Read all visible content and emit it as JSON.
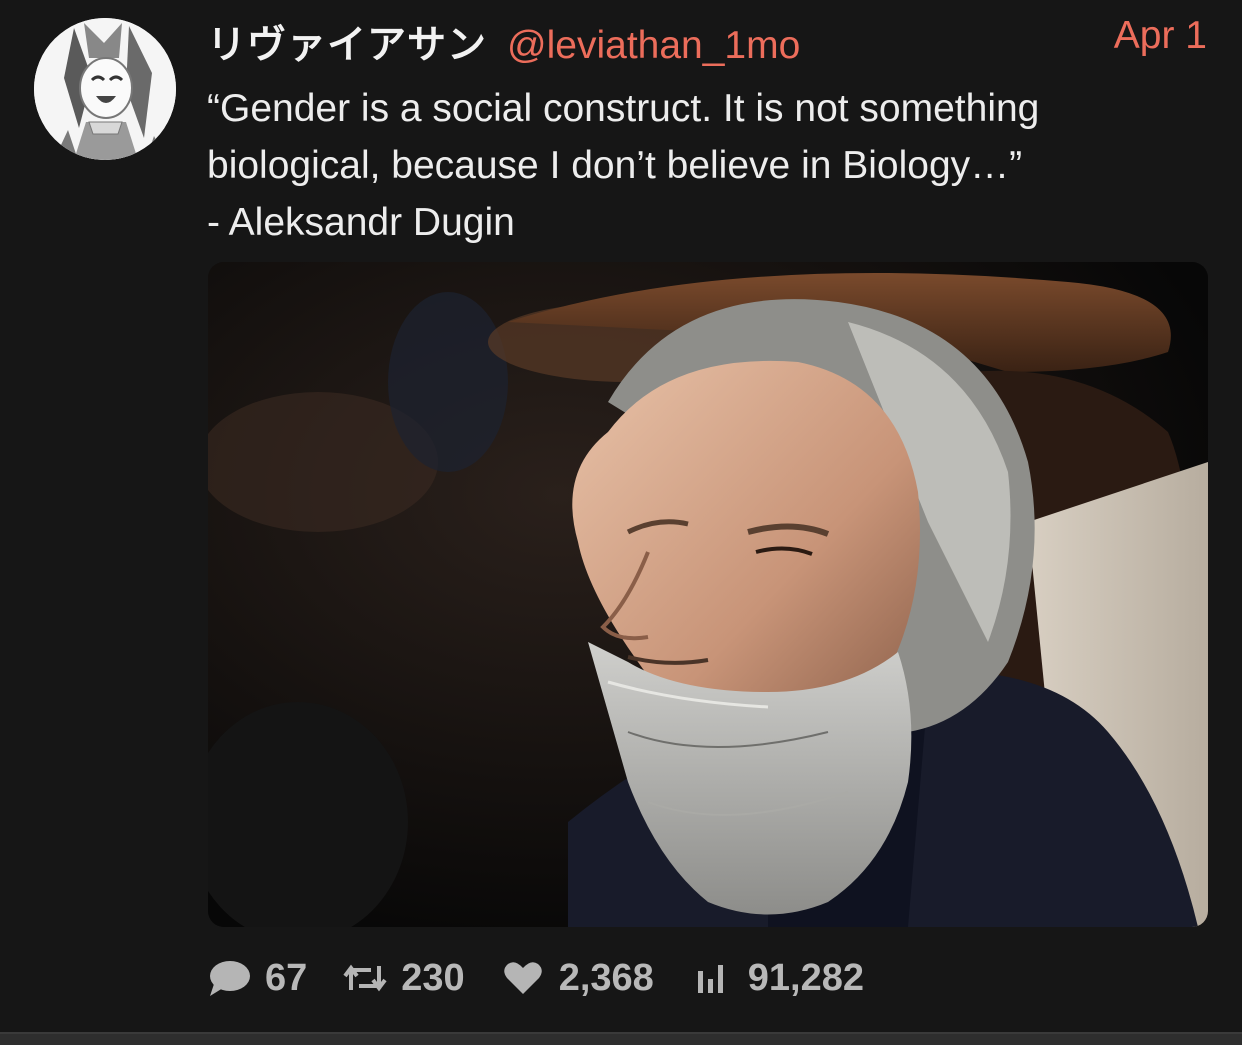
{
  "tweet": {
    "display_name": "リヴァイアサン",
    "handle": "@leviathan_1mo",
    "date": "Apr 1",
    "text": "“Gender is a social construct. It is not something\nbiological, because I don’t believe in Biology…”\n- Aleksandr Dugin"
  },
  "actions": {
    "replies": "67",
    "retweets": "230",
    "likes": "2,368",
    "views": "91,282"
  },
  "icons": {
    "reply": "speech-bubble-icon",
    "retweet": "retweet-arrows-icon",
    "like": "heart-icon",
    "views": "bar-chart-icon"
  },
  "colors": {
    "background": "#161616",
    "accent": "#ec6d5b",
    "text": "#ededed",
    "muted": "#b5b5b5"
  }
}
